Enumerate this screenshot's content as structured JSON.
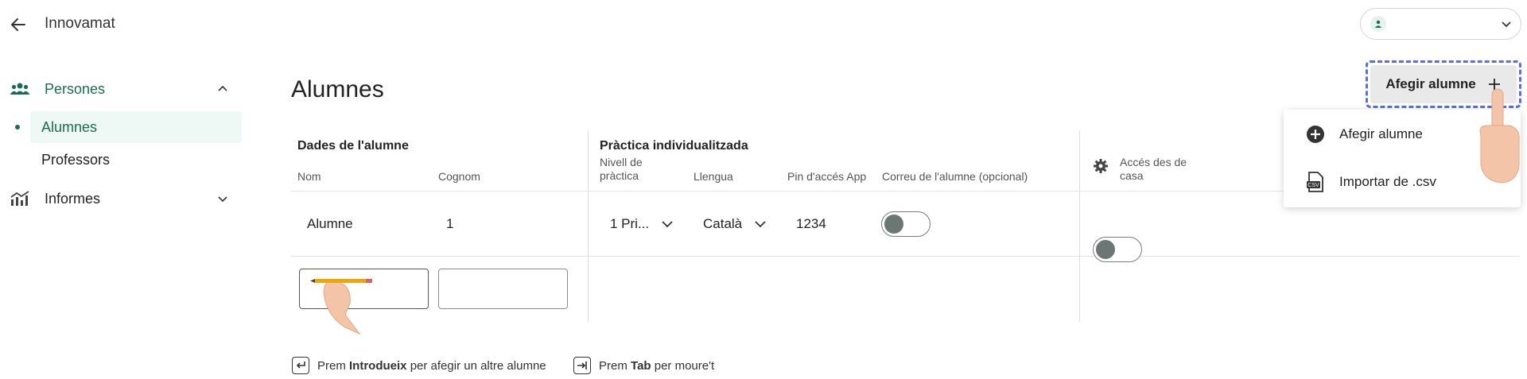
{
  "header": {
    "app_title": "Innovamat"
  },
  "sidebar": {
    "sections": [
      {
        "label": "Persones",
        "items": [
          {
            "label": "Alumnes"
          },
          {
            "label": "Professors"
          }
        ]
      },
      {
        "label": "Informes"
      }
    ]
  },
  "main": {
    "title": "Alumnes",
    "add_button_label": "Afegir alumne",
    "menu": [
      {
        "label": "Afegir alumne"
      },
      {
        "label": "Importar de .csv"
      }
    ],
    "groups": {
      "student_data": "Dades de l'alumne",
      "practice": "Pràctica individualitzada"
    },
    "columns": {
      "name": "Nom",
      "surname": "Cognom",
      "level_line1": "Nivell de",
      "level_line2": "pràctica",
      "language": "Llengua",
      "pin": "Pin d'accés App",
      "email": "Correu de l'alumne (opcional)",
      "home_access_line1": "Accés des de",
      "home_access_line2": "casa"
    },
    "rows": [
      {
        "name": "Alumne",
        "surname": "1",
        "level": "1 Pri...",
        "language": "Català",
        "pin": "1234",
        "email_toggle": false,
        "home_access": false
      }
    ],
    "new_row": {
      "name_value": "",
      "surname_value": ""
    },
    "hints": [
      {
        "pre": "Prem ",
        "key": "Introdueix",
        "post": " per afegir un altre alumne"
      },
      {
        "pre": "Prem ",
        "key": "Tab",
        "post": " per moure't"
      }
    ]
  },
  "colors": {
    "accent": "#1b6b55",
    "active_bg": "#eef8f4",
    "focus_outline": "#5b6fd6"
  }
}
